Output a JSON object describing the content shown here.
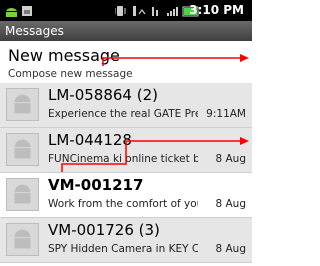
{
  "status_bar": {
    "time": "3:10 PM",
    "left_icons": [
      "android-icon",
      "image-icon"
    ],
    "right_icons": [
      "vibrate-icon",
      "data-icon",
      "wifi-icon",
      "signal-icon",
      "battery-icon"
    ]
  },
  "title_bar": {
    "title": "Messages"
  },
  "new_message": {
    "title": "New message",
    "subtitle": "Compose new message"
  },
  "threads": [
    {
      "name": "LM-058864 (2)",
      "preview": "Experience the real GATE Pre...",
      "date": "9:11AM",
      "unread": false
    },
    {
      "name": "LM-044128",
      "preview": "FUNCinema ki online ticket boo...",
      "date": "8 Aug",
      "unread": false
    },
    {
      "name": "VM-001217",
      "preview": "Work from the comfort of your ...",
      "date": "8 Aug",
      "unread": true
    },
    {
      "name": "VM-001726 (3)",
      "preview": "SPY Hidden Camera in KEY CHA...",
      "date": "8 Aug",
      "unread": false
    }
  ],
  "colors": {
    "status_bar": "#000000",
    "title_bar": "#4f4f4f",
    "read_row": "#e6e6e6",
    "annotation": "#ff0000"
  }
}
